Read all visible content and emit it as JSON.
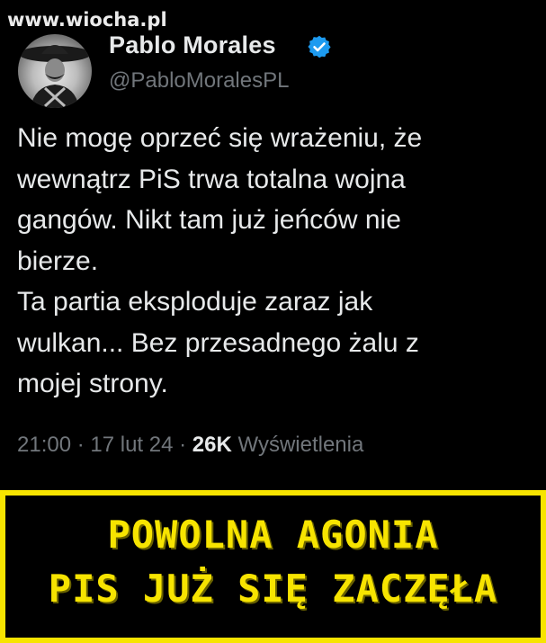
{
  "watermark": "www.wiocha.pl",
  "tweet": {
    "author": {
      "display_name": "Pablo Morales",
      "handle": "@PabloMoralesPL",
      "verified_icon": "verified-badge-icon",
      "avatar": "avatar"
    },
    "text_lines": [
      "Nie mogę oprzeć się wrażeniu, że",
      "wewnątrz PiS trwa totalna wojna",
      "gangów. Nikt tam już jeńców nie",
      "bierze.",
      "Ta partia eksploduje zaraz jak",
      "wulkan... Bez przesadnego żalu z",
      "mojej strony."
    ],
    "meta": {
      "time": "21:00",
      "separator": " · ",
      "date": "17 lut 24",
      "views_count": "26K",
      "views_label": " Wyświetlenia"
    }
  },
  "banner": {
    "line1": "POWOLNA AGONIA",
    "line2": "PIS JUŻ SIĘ ZACZĘŁA"
  },
  "colors": {
    "background": "#000000",
    "primary_text": "#e7e9ea",
    "secondary_text": "#71767b",
    "verified_blue": "#1d9bf0",
    "banner_yellow": "#f7e400"
  }
}
